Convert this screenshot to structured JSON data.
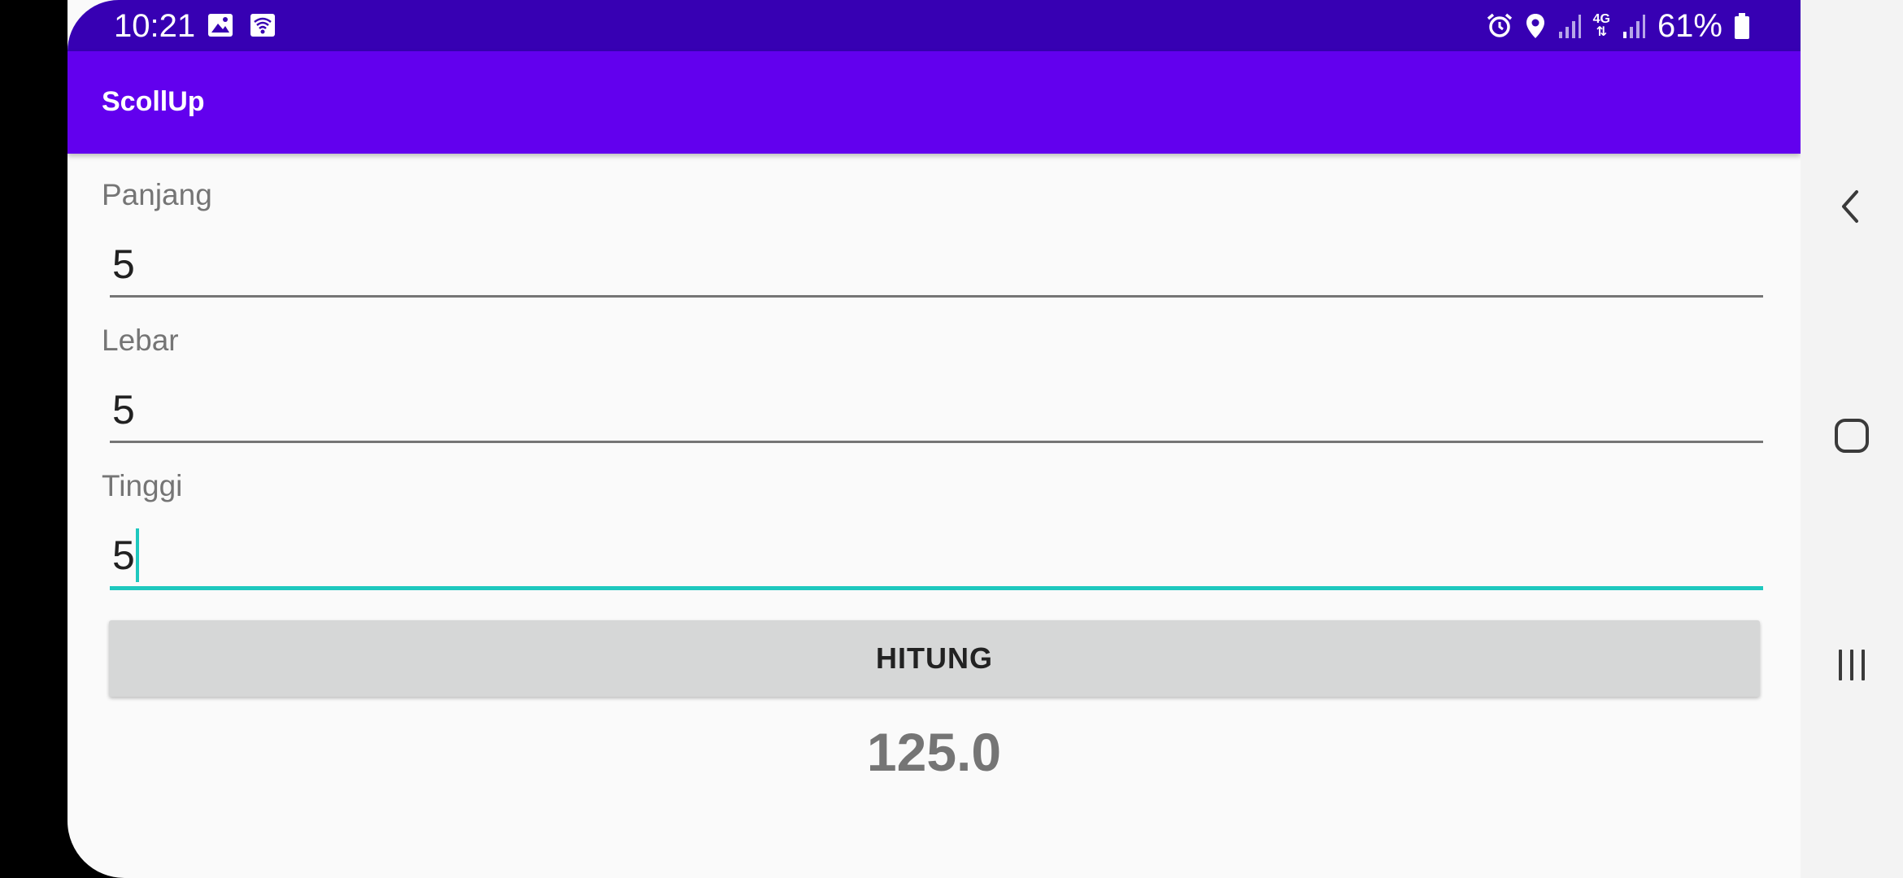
{
  "status_bar": {
    "time": "10:21",
    "battery": "61%",
    "left_icons": [
      "image-icon",
      "wifi-hotspot-icon"
    ],
    "right_icons": [
      "alarm-icon",
      "location-icon",
      "signal-icon",
      "4g-data-icon",
      "signal-icon",
      "battery-icon"
    ],
    "network_label": "4G"
  },
  "app_bar": {
    "title": "ScollUp"
  },
  "form": {
    "panjang": {
      "label": "Panjang",
      "value": "5"
    },
    "lebar": {
      "label": "Lebar",
      "value": "5"
    },
    "tinggi": {
      "label": "Tinggi",
      "value": "5"
    },
    "button_label": "HITUNG",
    "result": "125.0"
  },
  "nav_bar": {
    "buttons": [
      "back-icon",
      "home-icon",
      "recents-icon"
    ]
  },
  "colors": {
    "status_bar": "#3700b3",
    "app_bar": "#6200ee",
    "accent": "#1ec8be",
    "background": "#fafafa",
    "button": "#d6d7d7"
  }
}
